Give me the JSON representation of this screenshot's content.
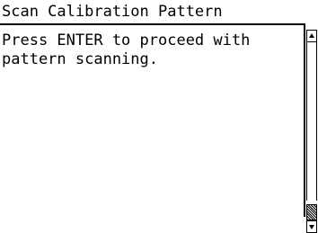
{
  "title": "Scan Calibration Pattern",
  "message": "Press ENTER to proceed with\npattern scanning.",
  "scrollbar": {
    "up_icon": "arrow-up-icon",
    "down_icon": "arrow-down-icon"
  },
  "colors": {
    "background": "#ffffff",
    "foreground": "#000000"
  }
}
